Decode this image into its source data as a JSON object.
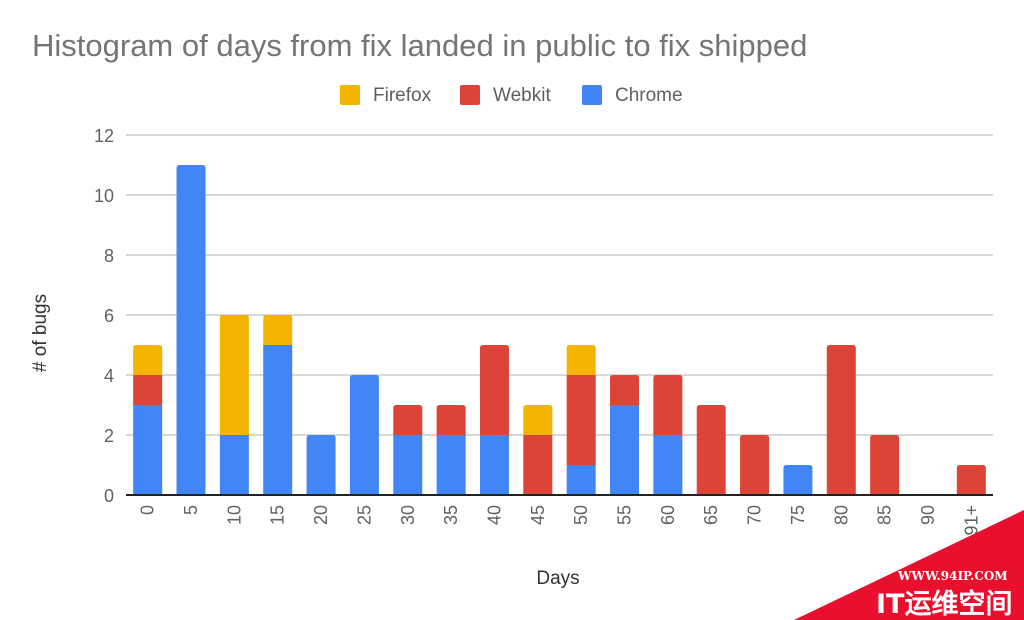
{
  "chart_data": {
    "type": "bar",
    "stacked": true,
    "title": "Histogram of days from fix landed in public to fix shipped",
    "xlabel": "Days",
    "ylabel": "# of bugs",
    "ylim": [
      0,
      12
    ],
    "yticks": [
      0,
      2,
      4,
      6,
      8,
      10,
      12
    ],
    "grid": true,
    "legend_position": "top",
    "categories": [
      "0",
      "5",
      "10",
      "15",
      "20",
      "25",
      "30",
      "35",
      "40",
      "45",
      "50",
      "55",
      "60",
      "65",
      "70",
      "75",
      "80",
      "85",
      "90",
      "91+"
    ],
    "series": [
      {
        "name": "Chrome",
        "color": "#4285f4",
        "values": [
          3,
          11,
          2,
          5,
          2,
          4,
          2,
          2,
          2,
          0,
          1,
          3,
          2,
          0,
          0,
          1,
          0,
          0,
          0,
          0
        ]
      },
      {
        "name": "Webkit",
        "color": "#db4437",
        "values": [
          1,
          0,
          0,
          0,
          0,
          0,
          1,
          1,
          3,
          2,
          3,
          1,
          2,
          3,
          2,
          0,
          5,
          2,
          0,
          1
        ]
      },
      {
        "name": "Firefox",
        "color": "#f4b400",
        "values": [
          1,
          0,
          4,
          1,
          0,
          0,
          0,
          0,
          0,
          1,
          1,
          0,
          0,
          0,
          0,
          0,
          0,
          0,
          0,
          0
        ]
      }
    ],
    "legend_order": [
      "Firefox",
      "Webkit",
      "Chrome"
    ]
  },
  "watermark": {
    "url": "WWW.94IP.COM",
    "name": "IT运维空间",
    "color": "#e8102c"
  }
}
